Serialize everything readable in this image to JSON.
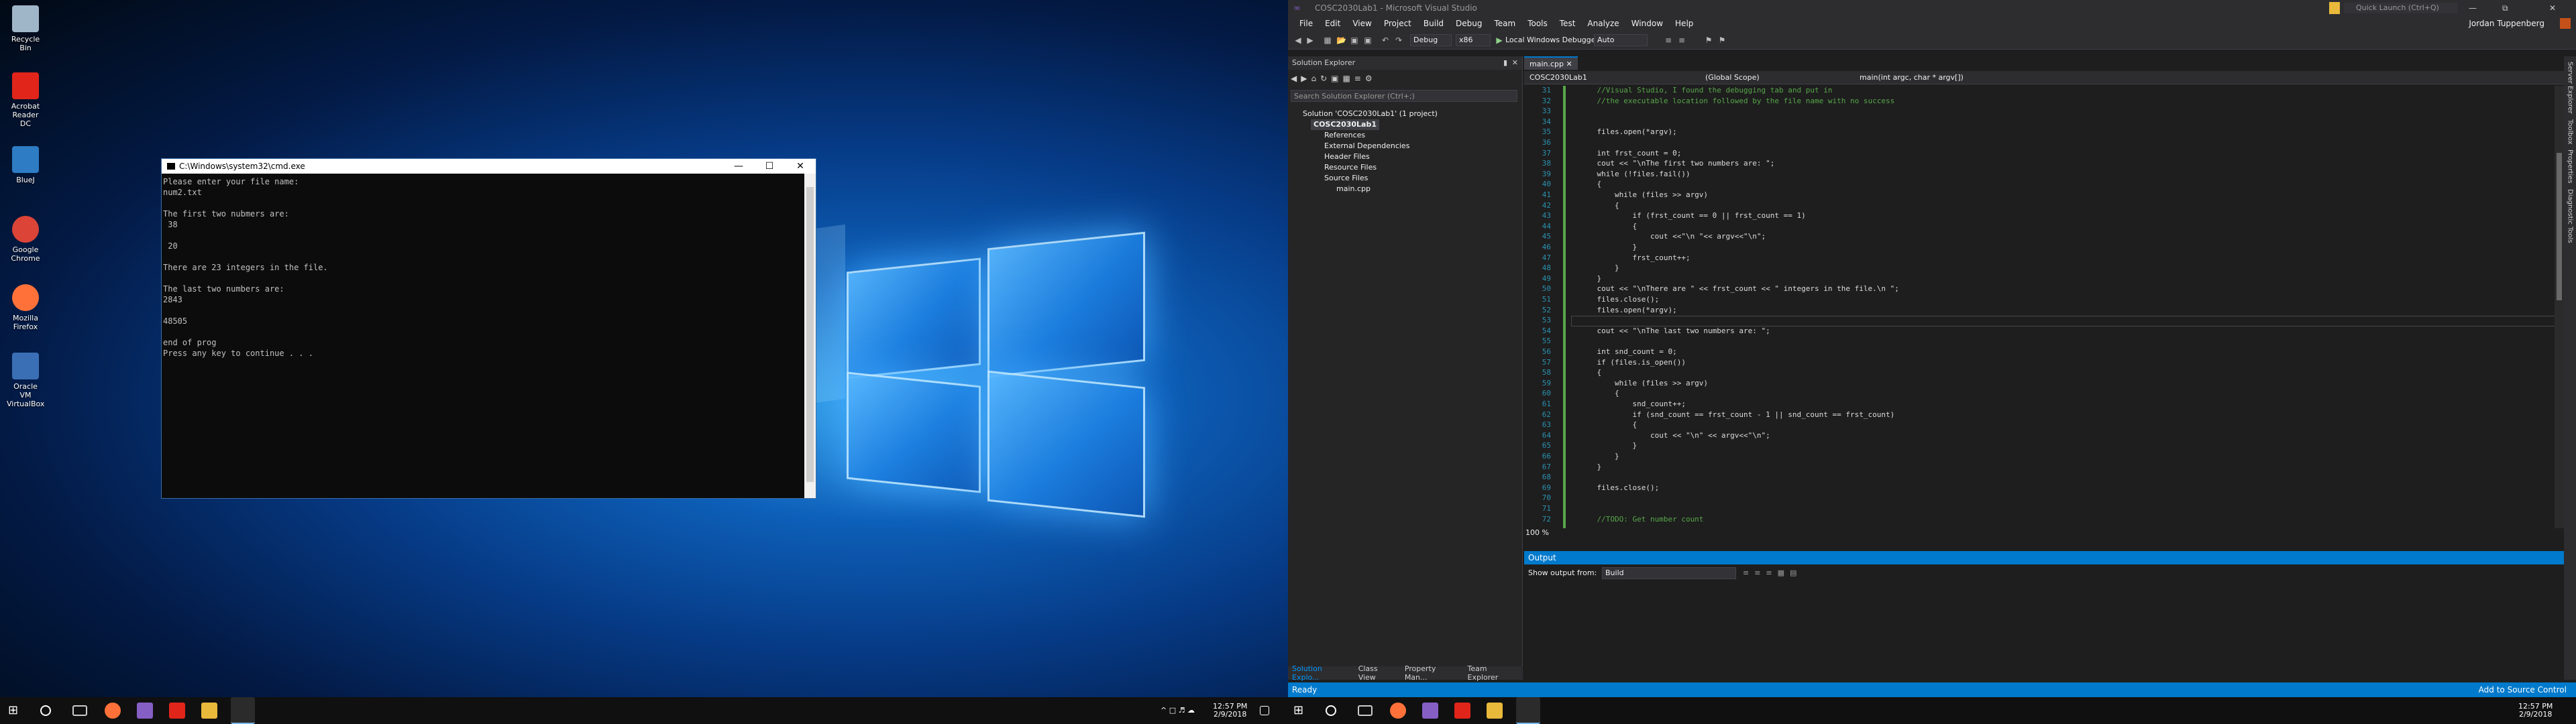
{
  "desktop": {
    "icons": [
      {
        "label": "Recycle Bin",
        "icon": "recycle-bin-icon",
        "color": "#9fb6c8"
      },
      {
        "label": "Acrobat Reader DC",
        "icon": "acrobat-icon",
        "color": "#e1251b"
      },
      {
        "label": "BlueJ",
        "icon": "bluej-icon",
        "color": "#2d7cc4"
      },
      {
        "label": "Google Chrome",
        "icon": "chrome-icon",
        "color": "#db4437"
      },
      {
        "label": "Mozilla Firefox",
        "icon": "firefox-icon",
        "color": "#ff7139"
      },
      {
        "label": "Oracle VM VirtualBox",
        "icon": "virtualbox-icon",
        "color": "#3a6fb6"
      }
    ]
  },
  "cmd": {
    "title": "C:\\Windows\\system32\\cmd.exe",
    "output": "Please enter your file name:\nnum2.txt\n\nThe first two nubmers are:\n 38\n\n 20\n\nThere are 23 integers in the file.\n\nThe last two numbers are:\n2843\n\n48505\n\nend of prog\nPress any key to continue . . ."
  },
  "taskbar": {
    "time": "12:57 PM",
    "date": "2/9/2018"
  },
  "vs": {
    "title": "COSC2030Lab1 - Microsoft Visual Studio",
    "quick_launch": "Quick Launch (Ctrl+Q)",
    "user": "Jordan Tuppenberg",
    "menu": [
      "File",
      "Edit",
      "View",
      "Project",
      "Build",
      "Debug",
      "Team",
      "Tools",
      "Test",
      "Analyze",
      "Window",
      "Help"
    ],
    "toolbar": {
      "config": "Debug",
      "platform": "x86",
      "debugger": "Local Windows Debugger",
      "mode": "Auto"
    },
    "solution_explorer": {
      "title": "Solution Explorer",
      "search": "Search Solution Explorer (Ctrl+;)",
      "items": [
        "Solution 'COSC2030Lab1' (1 project)",
        "COSC2030Lab1",
        "References",
        "External Dependencies",
        "Header Files",
        "Resource Files",
        "Source Files",
        "main.cpp"
      ],
      "tabs": [
        "Solution Explo...",
        "Class View",
        "Property Man...",
        "Team Explorer"
      ]
    },
    "editor": {
      "tab": "main.cpp",
      "project": "COSC2030Lab1",
      "scope": "(Global Scope)",
      "function": "main(int argc, char * argv[])",
      "zoom": "100 %",
      "lines": [
        {
          "n": "31",
          "t": "    //Visual Studio, I found the debugging tab and put in"
        },
        {
          "n": "32",
          "t": "    //the executable location followed by the file name with no success"
        },
        {
          "n": "33",
          "t": ""
        },
        {
          "n": "34",
          "t": ""
        },
        {
          "n": "35",
          "t": "    files.open(*argv);"
        },
        {
          "n": "36",
          "t": ""
        },
        {
          "n": "37",
          "t": "    int frst_count = 0;"
        },
        {
          "n": "38",
          "t": "    cout << \"\\nThe first two numbers are: \";"
        },
        {
          "n": "39",
          "t": "    while (!files.fail())"
        },
        {
          "n": "40",
          "t": "    {"
        },
        {
          "n": "41",
          "t": "        while (files >> argv)"
        },
        {
          "n": "42",
          "t": "        {"
        },
        {
          "n": "43",
          "t": "            if (frst_count == 0 || frst_count == 1)"
        },
        {
          "n": "44",
          "t": "            {"
        },
        {
          "n": "45",
          "t": "                cout <<\"\\n \"<< argv<<\"\\n\";"
        },
        {
          "n": "46",
          "t": "            }"
        },
        {
          "n": "47",
          "t": "            frst_count++;"
        },
        {
          "n": "48",
          "t": "        }"
        },
        {
          "n": "49",
          "t": "    }"
        },
        {
          "n": "50",
          "t": "    cout << \"\\nThere are \" << frst_count << \" integers in the file.\\n \";"
        },
        {
          "n": "51",
          "t": "    files.close();"
        },
        {
          "n": "52",
          "t": "    files.open(*argv);"
        },
        {
          "n": "53",
          "t": ""
        },
        {
          "n": "54",
          "t": "    cout << \"\\nThe last two numbers are: \";"
        },
        {
          "n": "55",
          "t": ""
        },
        {
          "n": "56",
          "t": "    int snd_count = 0;"
        },
        {
          "n": "57",
          "t": "    if (files.is_open())"
        },
        {
          "n": "58",
          "t": "    {"
        },
        {
          "n": "59",
          "t": "        while (files >> argv)"
        },
        {
          "n": "60",
          "t": "        {"
        },
        {
          "n": "61",
          "t": "            snd_count++;"
        },
        {
          "n": "62",
          "t": "            if (snd_count == frst_count - 1 || snd_count == frst_count)"
        },
        {
          "n": "63",
          "t": "            {"
        },
        {
          "n": "64",
          "t": "                cout << \"\\n\" << argv<<\"\\n\";"
        },
        {
          "n": "65",
          "t": "            }"
        },
        {
          "n": "66",
          "t": "        }"
        },
        {
          "n": "67",
          "t": "    }"
        },
        {
          "n": "68",
          "t": ""
        },
        {
          "n": "69",
          "t": "    files.close();"
        },
        {
          "n": "70",
          "t": ""
        },
        {
          "n": "71",
          "t": ""
        },
        {
          "n": "72",
          "t": "    //TODO: Get number count"
        }
      ]
    },
    "output": {
      "title": "Output",
      "show_from_label": "Show output from:",
      "source": "Build"
    },
    "status": "Ready",
    "add_source": "Add to Source Control",
    "right_tabs": [
      "Server Explorer",
      "Toolbox",
      "Properties",
      "Diagnostic Tools"
    ]
  }
}
